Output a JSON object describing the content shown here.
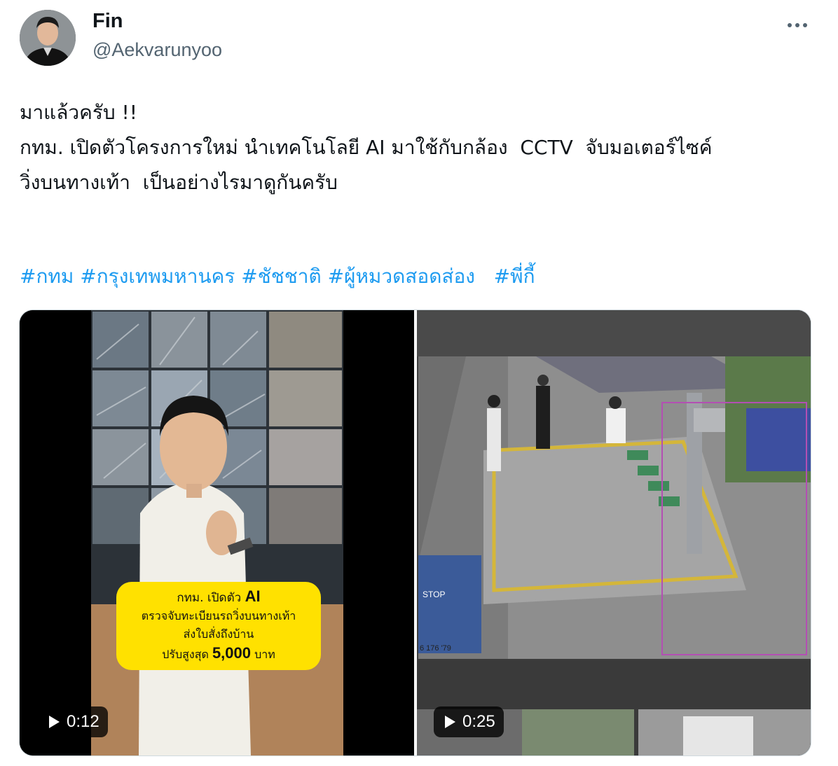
{
  "author": {
    "display_name": "Fin",
    "handle": "@Aekvarunyoo"
  },
  "tweet": {
    "lines": [
      "มาแล้วครับ !!",
      "",
      "กทม. เปิดตัวโครงการใหม่ นำเทคโนโลยี AI มาใช้กับกล้อง  CCTV  จับมอเตอร์ไซค์",
      "วิ่งบนทางเท้า  เป็นอย่างไรมาดูกันครับ"
    ],
    "hashtags": [
      "#กทม",
      "#กรุงเทพมหานคร",
      "#ชัชชาติ",
      "#ผู้หมวดสอดส่อง",
      "#พี่กี้"
    ]
  },
  "media": [
    {
      "duration": "0:12",
      "overlay": {
        "line1": "กทม. เปิดตัว",
        "line1_emph": "AI",
        "line2": "ตรวจจับทะเบียนรถวิ่งบนทางเท้า",
        "line3": "ส่งใบสั่งถึงบ้าน",
        "line4_pre": "ปรับสูงสุด",
        "line4_emph": "5,000",
        "line4_post": "บาท"
      }
    },
    {
      "duration": "0:25",
      "sign_text": "STOP",
      "plate_text": "6 176 '79"
    }
  ],
  "colors": {
    "link": "#1d9bf0",
    "text": "#0f1419",
    "secondary": "#536471",
    "overlay_bg": "#ffe100"
  },
  "icons": [
    "more-icon",
    "play-icon"
  ]
}
